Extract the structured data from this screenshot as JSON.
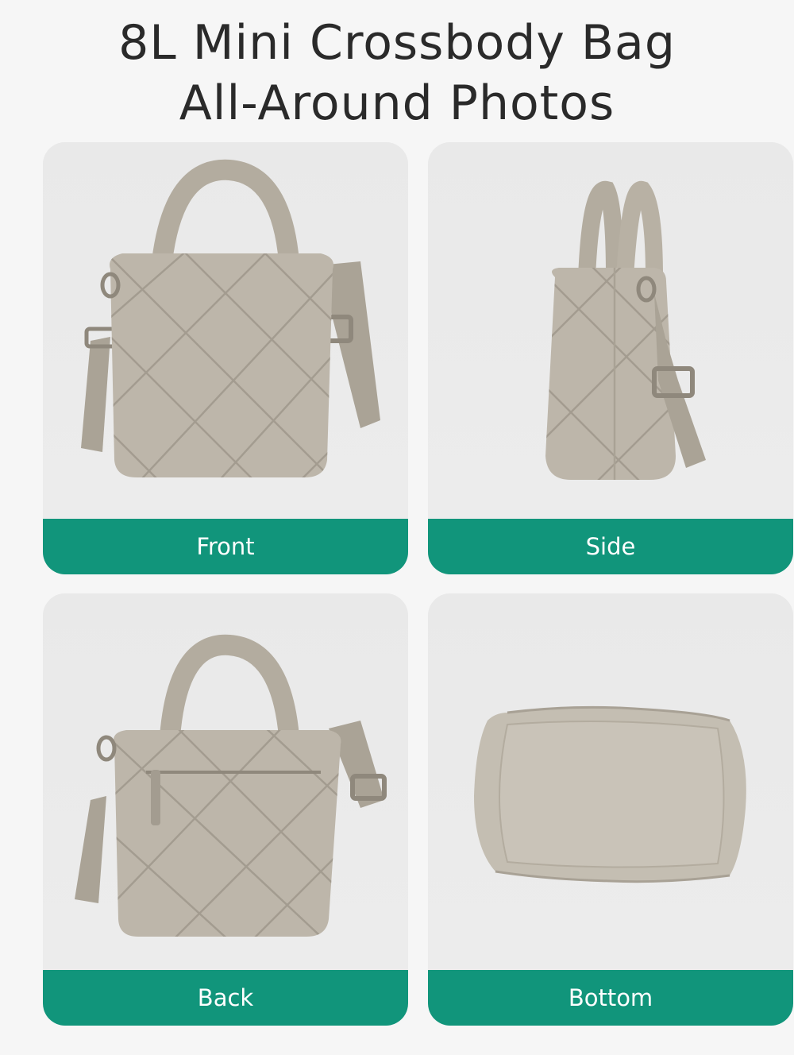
{
  "header": {
    "title_line1": "8L Mini Crossbody Bag",
    "title_line2": "All-Around Photos"
  },
  "views": [
    {
      "label": "Front"
    },
    {
      "label": "Side"
    },
    {
      "label": "Back"
    },
    {
      "label": "Bottom"
    }
  ],
  "colors": {
    "label_background": "#11957b",
    "label_text": "#ffffff",
    "bag_fabric": "#bdb6aa",
    "page_background": "#f6f6f6"
  }
}
